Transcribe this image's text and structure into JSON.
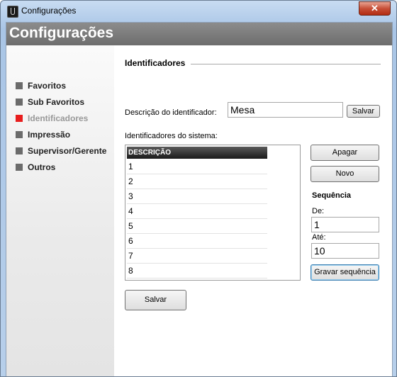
{
  "window": {
    "title": "Configurações"
  },
  "header": {
    "title": "Configurações"
  },
  "sidebar": {
    "items": [
      {
        "label": "Favoritos"
      },
      {
        "label": "Sub Favoritos"
      },
      {
        "label": "Identificadores",
        "active": true
      },
      {
        "label": "Impressão"
      },
      {
        "label": "Supervisor/Gerente"
      },
      {
        "label": "Outros"
      }
    ]
  },
  "identificadores": {
    "section_title": "Identificadores",
    "descricao_label": "Descrição do identificador:",
    "descricao_value": "Mesa",
    "salvar_small_label": "Salvar",
    "lista_label": "Identificadores do sistema:",
    "list_header": "DESCRIÇÃO",
    "rows": [
      "1",
      "2",
      "3",
      "4",
      "5",
      "6",
      "7",
      "8"
    ],
    "apagar_label": "Apagar",
    "novo_label": "Novo",
    "sequencia_title": "Sequência",
    "de_label": "De:",
    "de_value": "1",
    "ate_label": "Até:",
    "ate_value": "10",
    "gravar_label": "Gravar sequência",
    "salvar_label": "Salvar"
  },
  "colors": {
    "active_marker": "#e81e1e",
    "header_bg": "#7a7a7a"
  }
}
